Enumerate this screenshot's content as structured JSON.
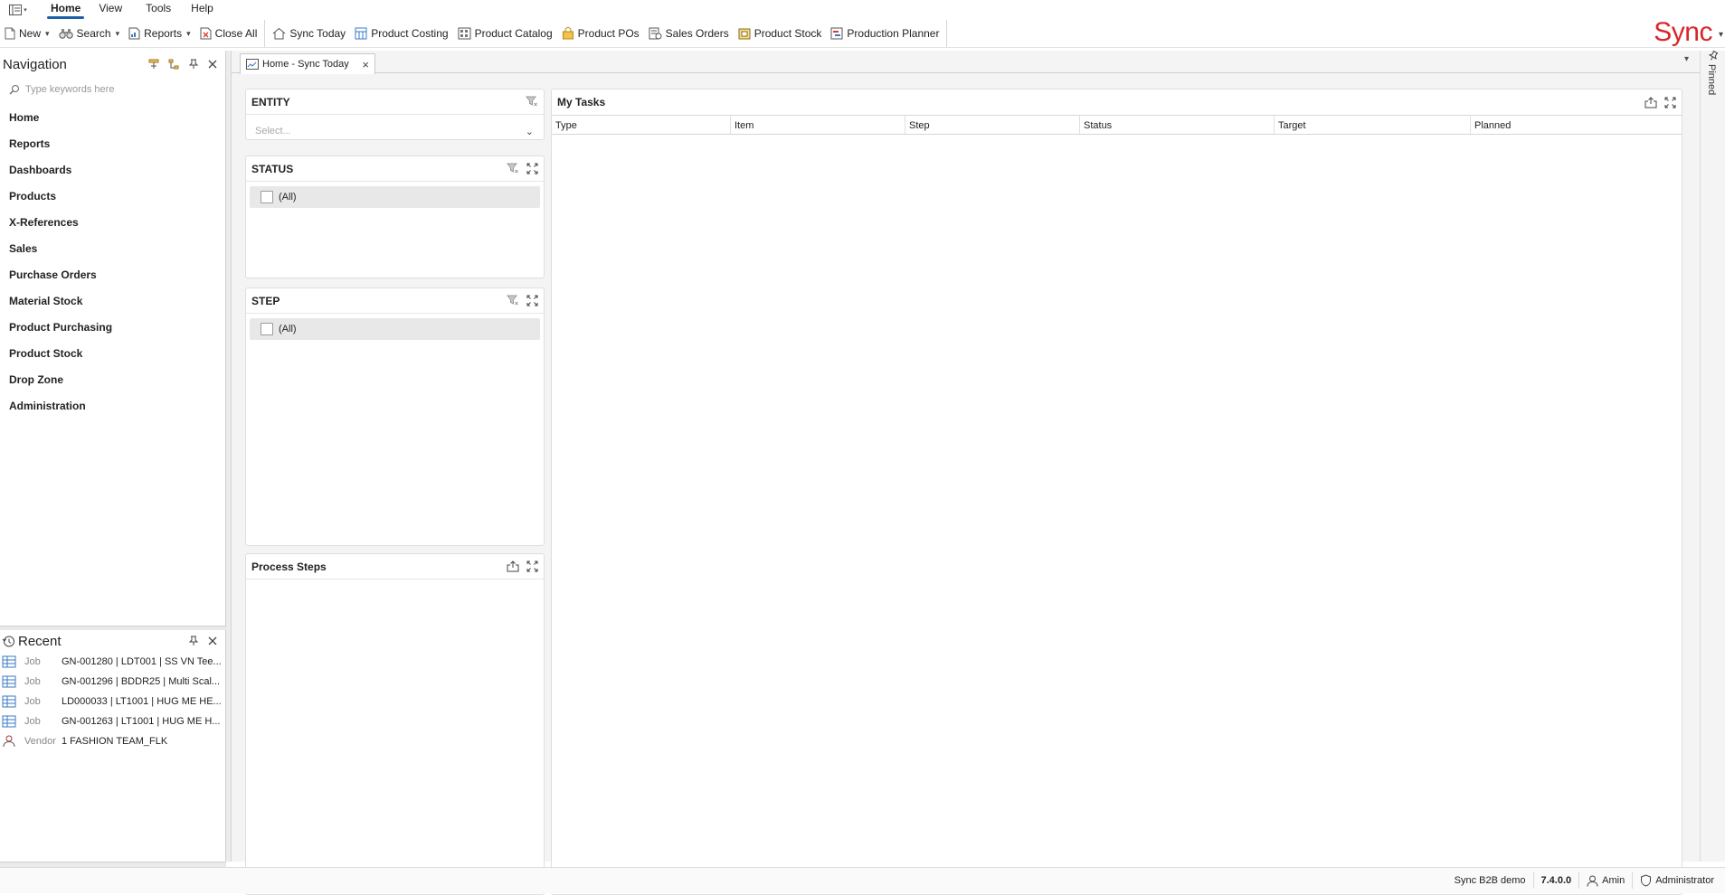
{
  "menubar": {
    "tabs": [
      {
        "label": "Home",
        "active": true
      },
      {
        "label": "View"
      },
      {
        "label": "Tools"
      },
      {
        "label": "Help"
      }
    ]
  },
  "toolbar": {
    "new_label": "New",
    "search_label": "Search",
    "reports_label": "Reports",
    "close_all_label": "Close All",
    "sync_today_label": "Sync Today",
    "product_costing_label": "Product Costing",
    "product_catalog_label": "Product Catalog",
    "product_pos_label": "Product POs",
    "sales_orders_label": "Sales Orders",
    "product_stock_label": "Product Stock",
    "production_planner_label": "Production Planner",
    "brand": "Sync",
    "brand_color": "#d8262c"
  },
  "navigation": {
    "title": "Navigation",
    "search_placeholder": "Type keywords here",
    "items": [
      {
        "label": "Home"
      },
      {
        "label": "Reports"
      },
      {
        "label": "Dashboards"
      },
      {
        "label": "Products"
      },
      {
        "label": "X-References"
      },
      {
        "label": "Sales"
      },
      {
        "label": "Purchase Orders"
      },
      {
        "label": "Material Stock"
      },
      {
        "label": "Product Purchasing"
      },
      {
        "label": "Product Stock"
      },
      {
        "label": "Drop Zone"
      },
      {
        "label": "Administration"
      }
    ]
  },
  "recent": {
    "title": "Recent",
    "items": [
      {
        "type": "Job",
        "name": "GN-001280 | LDT001 | SS VN Tee...",
        "icon": "grid-icon"
      },
      {
        "type": "Job",
        "name": "GN-001296 |  BDDR25 | Multi Scal...",
        "icon": "grid-icon"
      },
      {
        "type": "Job",
        "name": "LD000033 | LT1001 | HUG ME HE...",
        "icon": "grid-icon"
      },
      {
        "type": "Job",
        "name": "GN-001263 | LT1001 | HUG ME H...",
        "icon": "grid-icon"
      },
      {
        "type": "Vendor",
        "name": "1 FASHION TEAM_FLK",
        "icon": "person-icon"
      }
    ]
  },
  "document": {
    "tab_label": "Home - Sync Today",
    "entity": {
      "title": "ENTITY",
      "placeholder": "Select..."
    },
    "status": {
      "title": "STATUS",
      "option": "(All)"
    },
    "step": {
      "title": "STEP",
      "option": "(All)"
    },
    "process_steps": {
      "title": "Process Steps"
    },
    "my_tasks": {
      "title": "My Tasks",
      "columns": [
        "Type",
        "Item",
        "Step",
        "Status",
        "Target",
        "Planned"
      ]
    }
  },
  "pinned": {
    "label": "Pinned"
  },
  "statusbar": {
    "site": "Sync B2B demo",
    "version": "7.4.0.0",
    "user": "Amin",
    "role": "Administrator"
  }
}
